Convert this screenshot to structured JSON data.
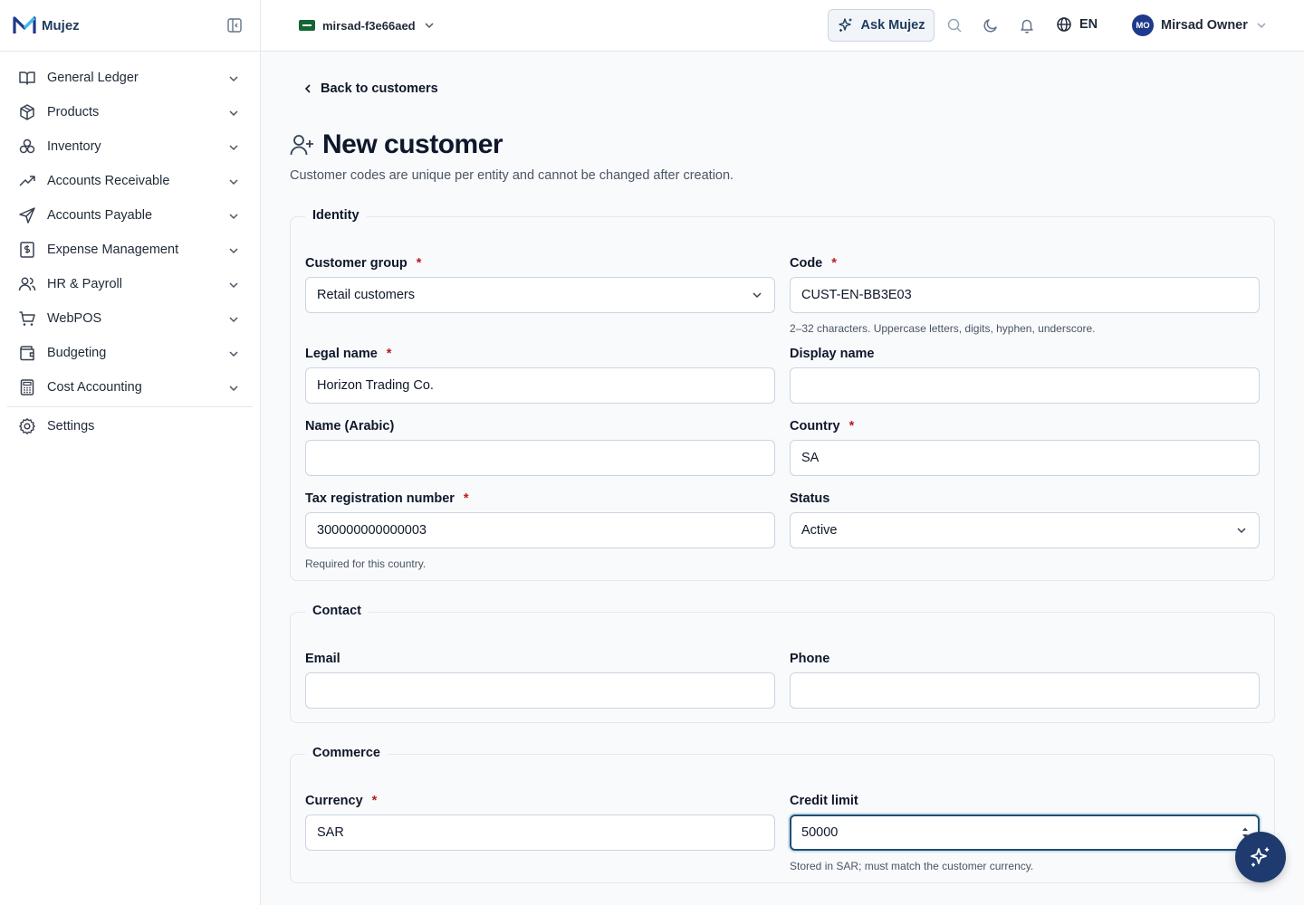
{
  "app": {
    "name": "Mujez"
  },
  "sidebar": {
    "items": [
      {
        "label": "General Ledger",
        "icon": "book-open-icon"
      },
      {
        "label": "Products",
        "icon": "package-icon"
      },
      {
        "label": "Inventory",
        "icon": "boxes-icon"
      },
      {
        "label": "Accounts Receivable",
        "icon": "trending-up-icon"
      },
      {
        "label": "Accounts Payable",
        "icon": "send-icon"
      },
      {
        "label": "Expense Management",
        "icon": "receipt-icon"
      },
      {
        "label": "HR & Payroll",
        "icon": "users-icon"
      },
      {
        "label": "WebPOS",
        "icon": "cart-icon"
      },
      {
        "label": "Budgeting",
        "icon": "wallet-icon"
      },
      {
        "label": "Cost Accounting",
        "icon": "calculator-icon"
      }
    ],
    "settings_label": "Settings"
  },
  "topbar": {
    "entity_name": "mirsad-f3e66aed",
    "ask_label": "Ask Mujez",
    "language": "EN",
    "user_initials": "MO",
    "user_name": "Mirsad Owner"
  },
  "page": {
    "back_label": "Back to customers",
    "title": "New customer",
    "subtitle": "Customer codes are unique per entity and cannot be changed after creation."
  },
  "identity": {
    "legend": "Identity",
    "customer_group": {
      "label": "Customer group",
      "value": "Retail customers"
    },
    "code": {
      "label": "Code",
      "value": "CUST-EN-BB3E03",
      "help": "2–32 characters. Uppercase letters, digits, hyphen, underscore."
    },
    "legal_name": {
      "label": "Legal name",
      "value": "Horizon Trading Co."
    },
    "display_name": {
      "label": "Display name",
      "value": ""
    },
    "name_arabic": {
      "label": "Name (Arabic)",
      "value": ""
    },
    "country": {
      "label": "Country",
      "value": "SA"
    },
    "tax_number": {
      "label": "Tax registration number",
      "value": "300000000000003",
      "help": "Required for this country."
    },
    "status": {
      "label": "Status",
      "value": "Active"
    }
  },
  "contact": {
    "legend": "Contact",
    "email": {
      "label": "Email",
      "value": ""
    },
    "phone": {
      "label": "Phone",
      "value": ""
    }
  },
  "commerce": {
    "legend": "Commerce",
    "currency": {
      "label": "Currency",
      "value": "SAR"
    },
    "credit_limit": {
      "label": "Credit limit",
      "value": "50000",
      "help": "Stored in SAR; must match the customer currency."
    }
  },
  "required_mark": "*"
}
